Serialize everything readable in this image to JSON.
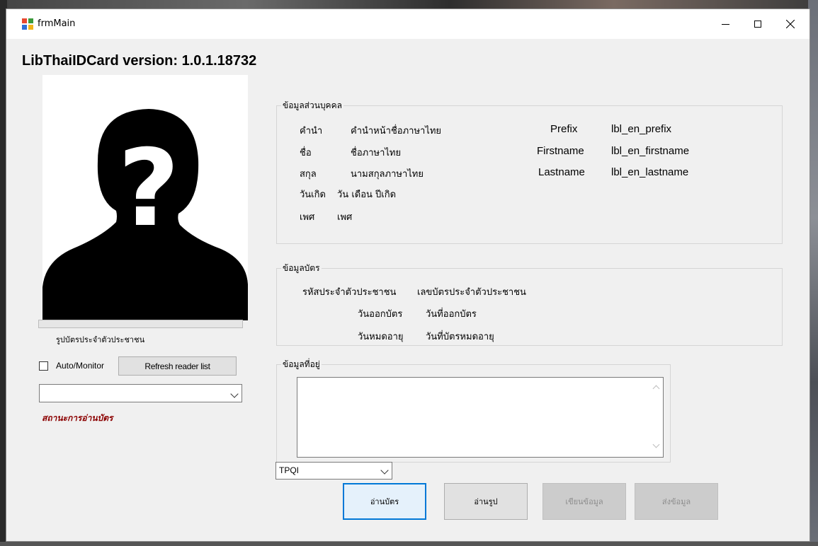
{
  "window": {
    "title": "frmMain",
    "app_version": "LibThaiIDCard version: 1.0.1.18732"
  },
  "photo_panel": {
    "photo_caption": "รูปบัตรประจำตัวประชาชน",
    "auto_monitor_label": "Auto/Monitor",
    "auto_monitor_checked": false,
    "refresh_button": "Refresh reader list",
    "reader_selected": "",
    "read_status": "สถานะการอ่านบัตร"
  },
  "personal": {
    "legend": "ข้อมูลส่วนบุคคล",
    "thai_rows": [
      {
        "label": "คำนำ",
        "value": "คำนำหน้าชื่อภาษาไทย"
      },
      {
        "label": "ชื่อ",
        "value": "ชื่อภาษาไทย"
      },
      {
        "label": "สกุล",
        "value": "นามสกุลภาษาไทย"
      },
      {
        "label": "วันเกิด",
        "value": "วัน เดือน ปีเกิด"
      },
      {
        "label": "เพศ",
        "value": "เพศ"
      }
    ],
    "en_rows": [
      {
        "label": "Prefix",
        "value": "lbl_en_prefix"
      },
      {
        "label": "Firstname",
        "value": "lbl_en_firstname"
      },
      {
        "label": "Lastname",
        "value": "lbl_en_lastname"
      }
    ]
  },
  "card": {
    "legend": "ข้อมูลบัตร",
    "rows": [
      {
        "label": "รหัสประจำตัวประชาชน",
        "value": "เลขบัตรประจำตัวประชาชน"
      },
      {
        "label": "วันออกบัตร",
        "value": "วันที่ออกบัตร"
      },
      {
        "label": "วันหมดอายุ",
        "value": "วันที่บัตรหมดอายุ"
      }
    ]
  },
  "address": {
    "legend": "ข้อมูลที่อยู่",
    "text": ""
  },
  "reader_mode": {
    "selected": "TPQI"
  },
  "actions": {
    "read_card": "อ่านบัตร",
    "read_photo": "อ่านรูป",
    "write_data": "เขียนข้อมูล",
    "send_data": "ส่งข้อมูล"
  },
  "colors": {
    "status_text": "#8b0000",
    "focus_border": "#0078d7",
    "app_icon": [
      "#e8482f",
      "#3a9a3a",
      "#2f6fd8",
      "#f2b41b"
    ]
  }
}
